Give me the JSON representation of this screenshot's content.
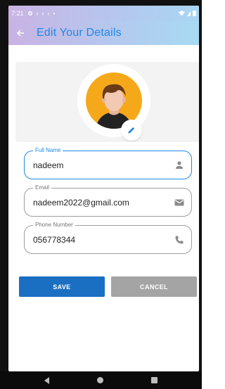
{
  "status_bar": {
    "time": "7:21",
    "icons": [
      "settings-icon",
      "notification-icon",
      "notification-icon",
      "notification-icon",
      "dot-icon"
    ],
    "right_icons": [
      "wifi-icon",
      "signal-icon",
      "battery-icon"
    ]
  },
  "app_bar": {
    "back_icon": "arrow-back-icon",
    "title": "Edit Your Details"
  },
  "profile": {
    "avatar_icon": "user-avatar-icon",
    "edit_icon": "pencil-icon"
  },
  "form": {
    "full_name": {
      "label": "Full Name",
      "value": "nadeem",
      "icon": "person-icon"
    },
    "email": {
      "label": "Email",
      "value": "nadeem2022@gmail.com",
      "icon": "mail-icon"
    },
    "phone": {
      "label": "Phone Number",
      "value": "056778344",
      "icon": "phone-icon"
    }
  },
  "actions": {
    "save_label": "SAVE",
    "cancel_label": "CANCEL"
  },
  "colors": {
    "accent": "#1e88e5",
    "save_button": "#1a6fc3",
    "cancel_button": "#a4a4a4",
    "avatar_bg": "#f5a91a"
  },
  "nav": {
    "icons": [
      "nav-back-icon",
      "nav-home-icon",
      "nav-recent-icon"
    ]
  }
}
